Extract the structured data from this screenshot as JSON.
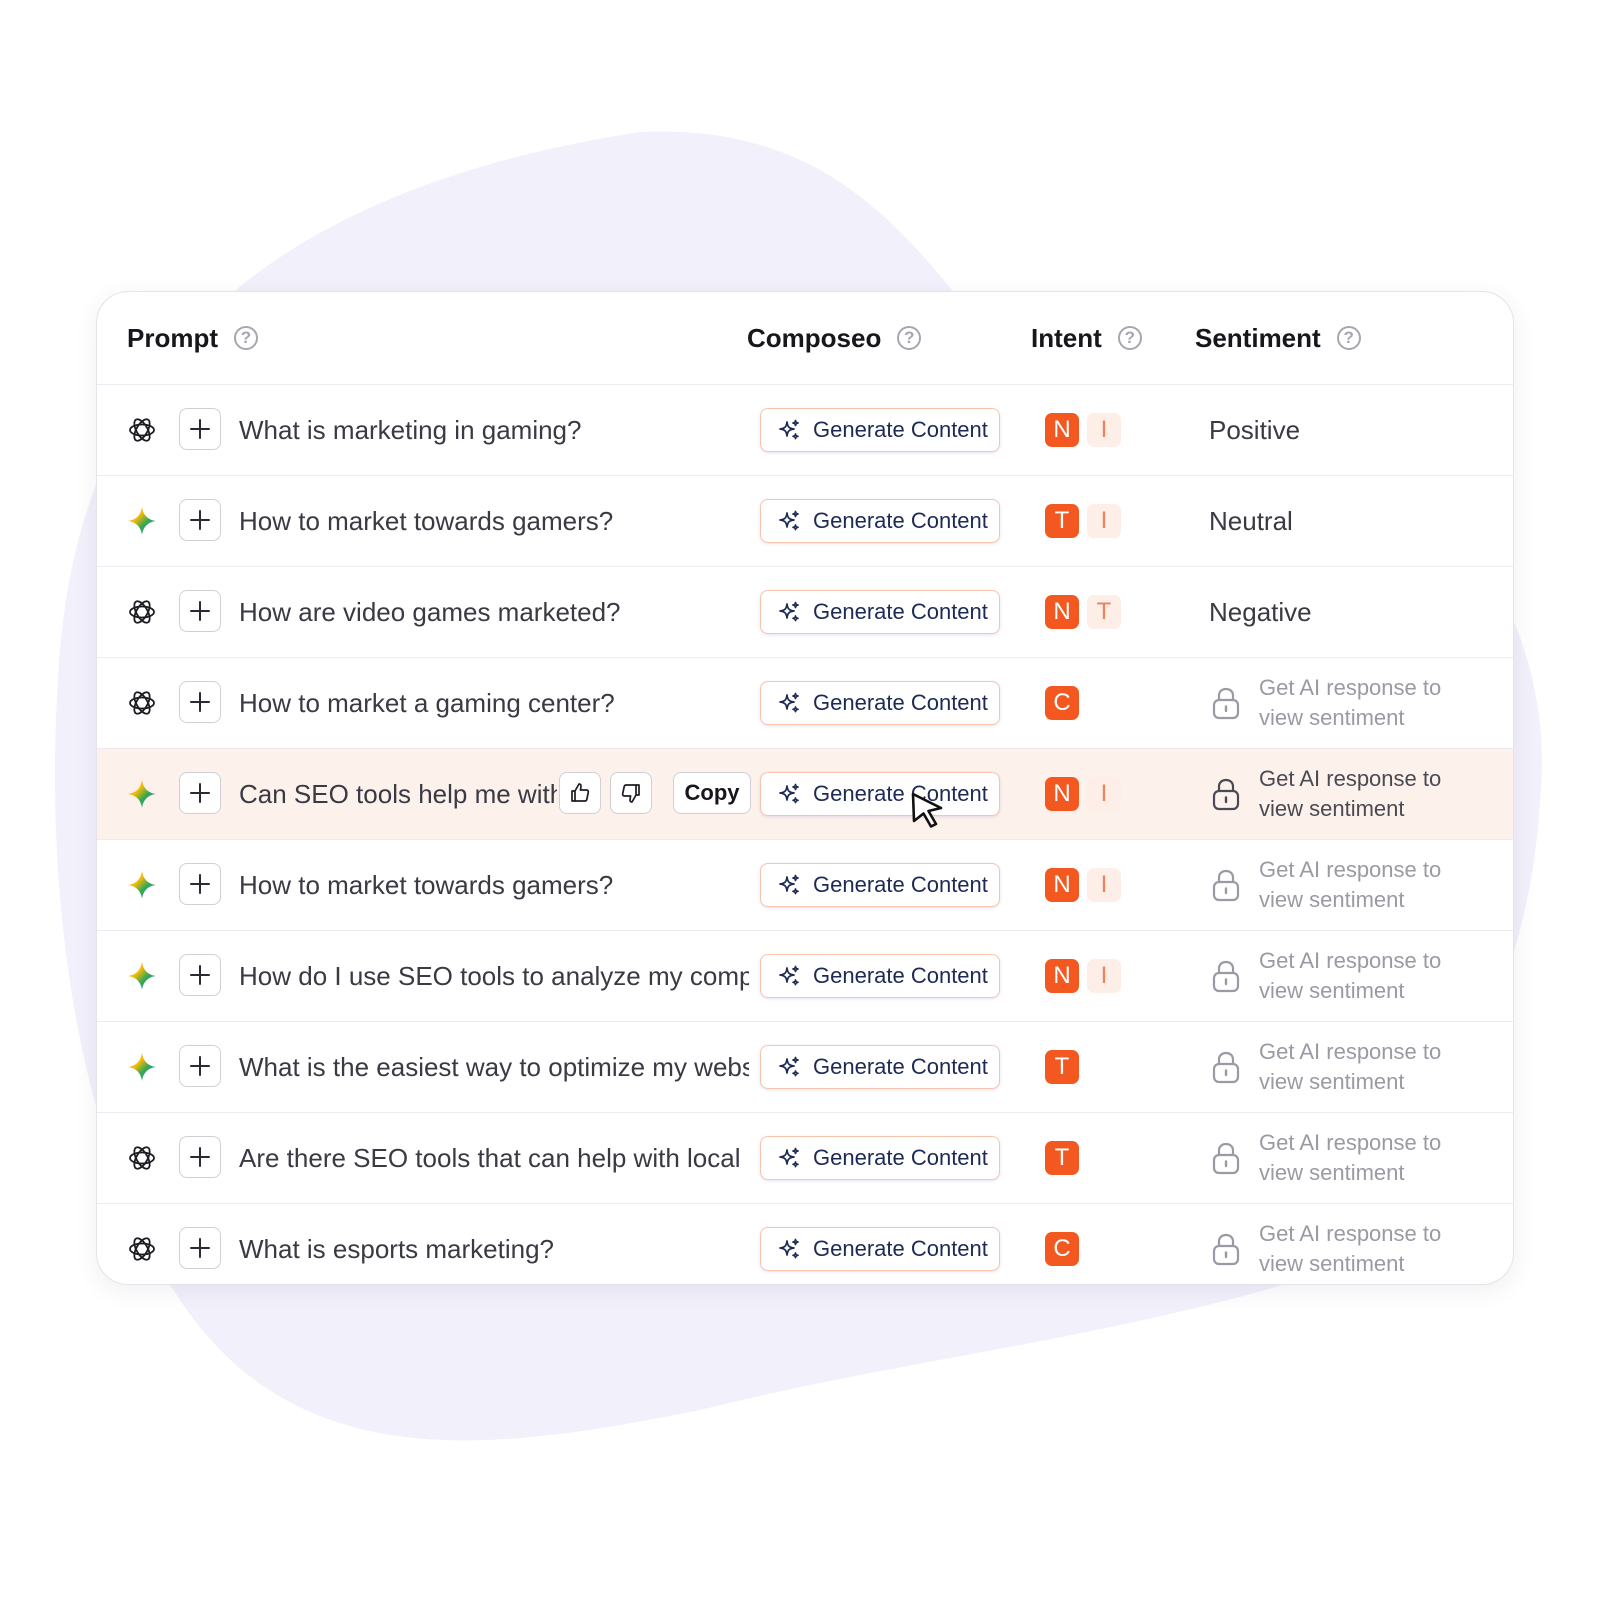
{
  "columns": {
    "prompt": "Prompt",
    "composeo": "Composeo",
    "intent": "Intent",
    "sentiment": "Sentiment"
  },
  "help_icon_glyph": "?",
  "generate_label": "Generate Content",
  "copy_label": "Copy",
  "locked_sentiment_text": "Get AI response to view sentiment",
  "colors": {
    "intent_primary": "#f2581f",
    "intent_secondary_bg": "#fdeee7",
    "active_row_bg": "#fdf1ec",
    "background_blob": "#f1f0fb"
  },
  "rows": [
    {
      "source": "chatgpt-icon",
      "prompt": "What is marketing in gaming?",
      "intents": [
        "N",
        "I"
      ],
      "sentiment": "Positive",
      "locked": false,
      "active": false
    },
    {
      "source": "gemini-icon",
      "prompt": "How to market towards gamers?",
      "intents": [
        "T",
        "I"
      ],
      "sentiment": "Neutral",
      "locked": false,
      "active": false
    },
    {
      "source": "chatgpt-icon",
      "prompt": "How are video games marketed?",
      "intents": [
        "N",
        "T"
      ],
      "sentiment": "Negative",
      "locked": false,
      "active": false
    },
    {
      "source": "chatgpt-icon",
      "prompt": "How to market a gaming center?",
      "intents": [
        "C"
      ],
      "sentiment": "",
      "locked": true,
      "active": false
    },
    {
      "source": "gemini-icon",
      "prompt": "Can SEO tools help me with",
      "intents": [
        "N",
        "I"
      ],
      "sentiment": "",
      "locked": true,
      "active": true
    },
    {
      "source": "gemini-icon",
      "prompt": "How to market towards gamers?",
      "intents": [
        "N",
        "I"
      ],
      "sentiment": "",
      "locked": true,
      "active": false
    },
    {
      "source": "gemini-icon",
      "prompt": "How do I use SEO tools to analyze my comp",
      "intents": [
        "N",
        "I"
      ],
      "sentiment": "",
      "locked": true,
      "active": false
    },
    {
      "source": "gemini-icon",
      "prompt": "What is the easiest way to optimize my webs",
      "intents": [
        "T"
      ],
      "sentiment": "",
      "locked": true,
      "active": false
    },
    {
      "source": "chatgpt-icon",
      "prompt": "Are there SEO tools that can help with local S",
      "intents": [
        "T"
      ],
      "sentiment": "",
      "locked": true,
      "active": false
    },
    {
      "source": "chatgpt-icon",
      "prompt": "What is esports marketing?",
      "intents": [
        "C"
      ],
      "sentiment": "",
      "locked": true,
      "active": false
    }
  ]
}
